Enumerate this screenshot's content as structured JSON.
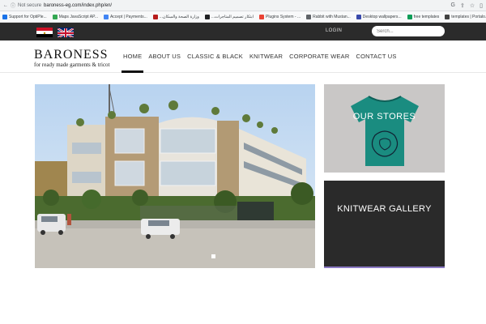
{
  "browser": {
    "security_label": "Not secure",
    "url": "baroness-eg.com/index.php/en/",
    "bookmarks": [
      {
        "label": "Support for OptiPle...",
        "color": "#1a73e8"
      },
      {
        "label": "Maps JavaScript AP...",
        "color": "#34a853"
      },
      {
        "label": "Accept | Payments...",
        "color": "#4285f4"
      },
      {
        "label": "...وزارة الصحة والسكان",
        "color": "#b71c1c"
      },
      {
        "label": "...ابتكار تصميم المتاجرات",
        "color": "#202124"
      },
      {
        "label": "Plugins System - ...",
        "color": "#ea4335"
      },
      {
        "label": "Rabbit with Mustan...",
        "color": "#5f6368"
      },
      {
        "label": "Desktop wallpapers...",
        "color": "#3949ab"
      },
      {
        "label": "free templates",
        "color": "#0f9d58"
      },
      {
        "label": "templates | Portalo...",
        "color": "#424242"
      }
    ]
  },
  "topbar": {
    "login_label": "LOGIN",
    "search_placeholder": "Serch..."
  },
  "logo": {
    "name": "BARONESS",
    "tagline": "for ready made garments & tricot"
  },
  "nav": {
    "items": [
      {
        "label": "HOME",
        "active": true
      },
      {
        "label": "ABOUT US",
        "active": false
      },
      {
        "label": "CLASSIC & BLACK",
        "active": false
      },
      {
        "label": "KNITWEAR",
        "active": false
      },
      {
        "label": "CORPORATE WEAR",
        "active": false
      },
      {
        "label": "CONTACT US",
        "active": false
      }
    ]
  },
  "tiles": {
    "stores_label": "OUR STORES",
    "knit_label": "KNITWEAR GALLERY"
  },
  "colors": {
    "topbar_bg": "#2b2b2b",
    "tshirt": "#1a8c80",
    "knit_border": "#8a79c3"
  }
}
